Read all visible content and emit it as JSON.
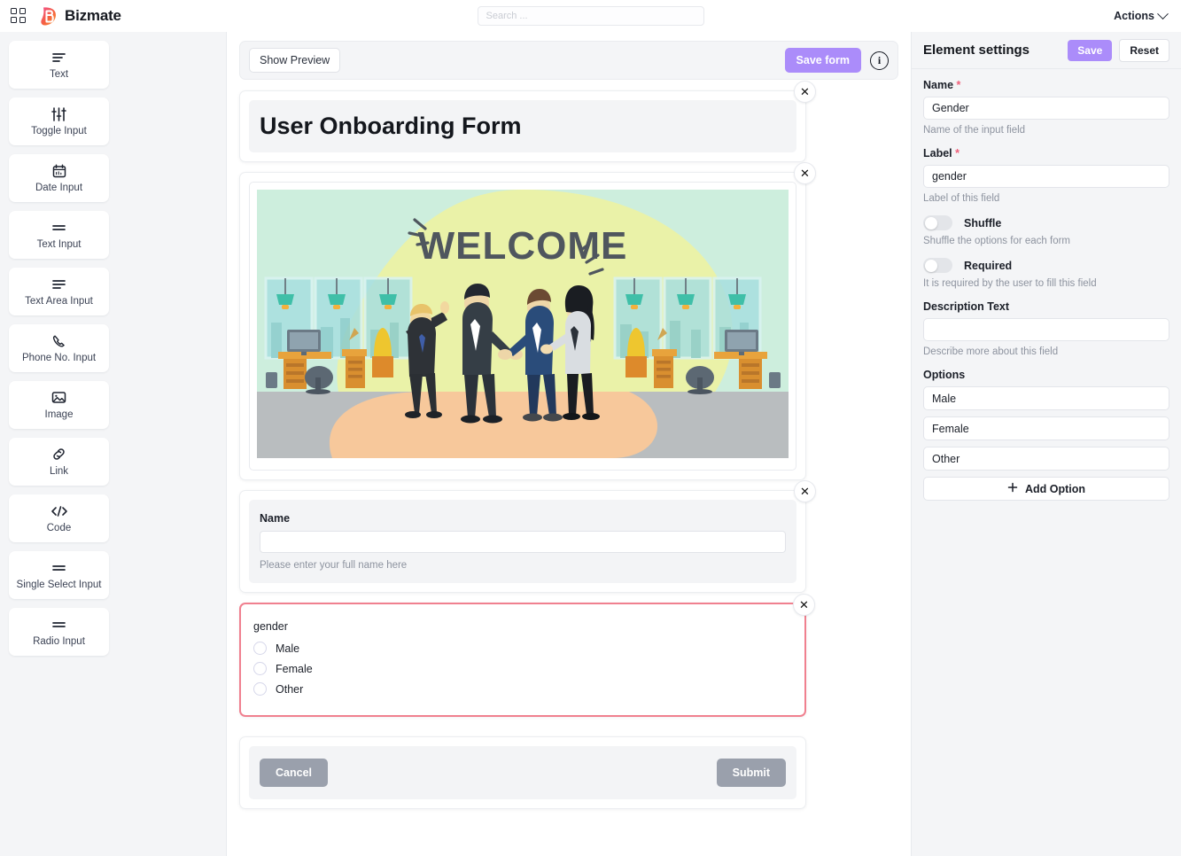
{
  "topbar": {
    "grid_icon": "apps-grid-icon",
    "brand": "Bizmate",
    "search_placeholder": "Search ...",
    "actions_label": "Actions"
  },
  "palette": {
    "items": [
      {
        "label": "Text",
        "icon": "text-lines-icon"
      },
      {
        "label": "Toggle Input",
        "icon": "sliders-icon"
      },
      {
        "label": "Date Input",
        "icon": "calendar-icon"
      },
      {
        "label": "Text Input",
        "icon": "two-lines-icon"
      },
      {
        "label": "Text Area Input",
        "icon": "text-align-left-icon"
      },
      {
        "label": "Phone No. Input",
        "icon": "phone-icon"
      },
      {
        "label": "Image",
        "icon": "image-icon"
      },
      {
        "label": "Link",
        "icon": "link-icon"
      },
      {
        "label": "Code",
        "icon": "code-icon"
      },
      {
        "label": "Single Select Input",
        "icon": "two-lines-icon"
      },
      {
        "label": "Radio Input",
        "icon": "two-lines-icon"
      }
    ]
  },
  "toolbar": {
    "show_preview": "Show Preview",
    "save_form": "Save form",
    "info_icon": "info-circle-icon",
    "close_icon": "✕"
  },
  "form": {
    "title": "User Onboarding Form",
    "image_alt": "WELCOME office illustration",
    "image_word": "WELCOME",
    "name_field": {
      "label": "Name",
      "value": "",
      "help": "Please enter your full name here"
    },
    "gender_field": {
      "label": "gender",
      "options": [
        "Male",
        "Female",
        "Other"
      ],
      "selected": true
    },
    "cancel_label": "Cancel",
    "submit_label": "Submit"
  },
  "settings": {
    "title": "Element settings",
    "save_label": "Save",
    "reset_label": "Reset",
    "name": {
      "label": "Name",
      "required_mark": "*",
      "value": "Gender",
      "help": "Name of the input field"
    },
    "label_field": {
      "label": "Label",
      "required_mark": "*",
      "value": "gender",
      "help": "Label of this field"
    },
    "shuffle": {
      "label": "Shuffle",
      "help": "Shuffle the options for each form",
      "on": false
    },
    "required": {
      "label": "Required",
      "help": "It is required by the user to fill this field",
      "on": false
    },
    "description": {
      "label": "Description Text",
      "value": "",
      "help": "Describe more about this field"
    },
    "options": {
      "label": "Options",
      "values": [
        "Male",
        "Female",
        "Other"
      ],
      "add_label": "Add Option",
      "add_icon": "plus-icon"
    }
  },
  "colors": {
    "accent_purple": "#ab8cfa",
    "selection_pink": "#f0808f",
    "required_red": "#f0607a",
    "panel_gray": "#f4f5f7",
    "button_gray": "#9aa0ac"
  }
}
